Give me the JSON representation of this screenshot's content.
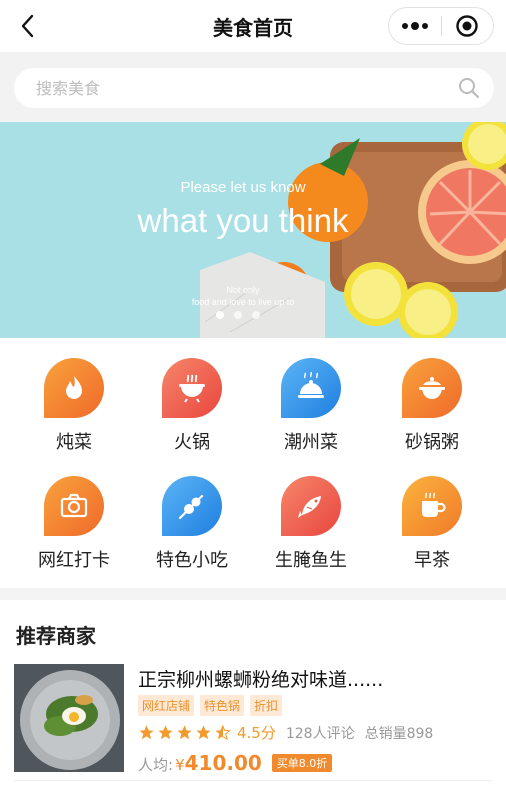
{
  "nav": {
    "title": "美食首页"
  },
  "search": {
    "placeholder": "搜索美食"
  },
  "banner": {
    "line1": "Please let us know",
    "line2": "what you think",
    "line3": "Not only",
    "line4": "food and love to live up to",
    "dots": 3,
    "active_dot": 0
  },
  "categories": [
    {
      "label": "炖菜",
      "icon": "flame-icon",
      "color": "#f07b2c"
    },
    {
      "label": "火锅",
      "icon": "hotpot-icon",
      "color": "#ee5c4a"
    },
    {
      "label": "潮州菜",
      "icon": "cloche-icon",
      "color": "#2e8fe8"
    },
    {
      "label": "砂锅粥",
      "icon": "claypot-icon",
      "color": "#f07b2c"
    },
    {
      "label": "网红打卡",
      "icon": "camera-icon",
      "color": "#f07b2c"
    },
    {
      "label": "特色小吃",
      "icon": "skewer-icon",
      "color": "#2e8fe8"
    },
    {
      "label": "生腌鱼生",
      "icon": "fish-icon",
      "color": "#ee5c4a"
    },
    {
      "label": "早茶",
      "icon": "teacup-icon",
      "color": "#f59a2c"
    }
  ],
  "recommend": {
    "title": "推荐商家",
    "shops": [
      {
        "name": "正宗柳州螺蛳粉绝对味道......",
        "tags": [
          "网红店铺",
          "特色锅",
          "折扣"
        ],
        "rating": 4.5,
        "score_text": "4.5分",
        "reviews": "128人评论",
        "sales": "总销量898",
        "avg_label": "人均:",
        "currency": "¥",
        "price": "410.00",
        "discount": "买单8.0折"
      }
    ]
  },
  "colors": {
    "accent": "#f08a2c",
    "tag_bg": "#fde9d6",
    "banner_bg": "#a9e0e6"
  }
}
